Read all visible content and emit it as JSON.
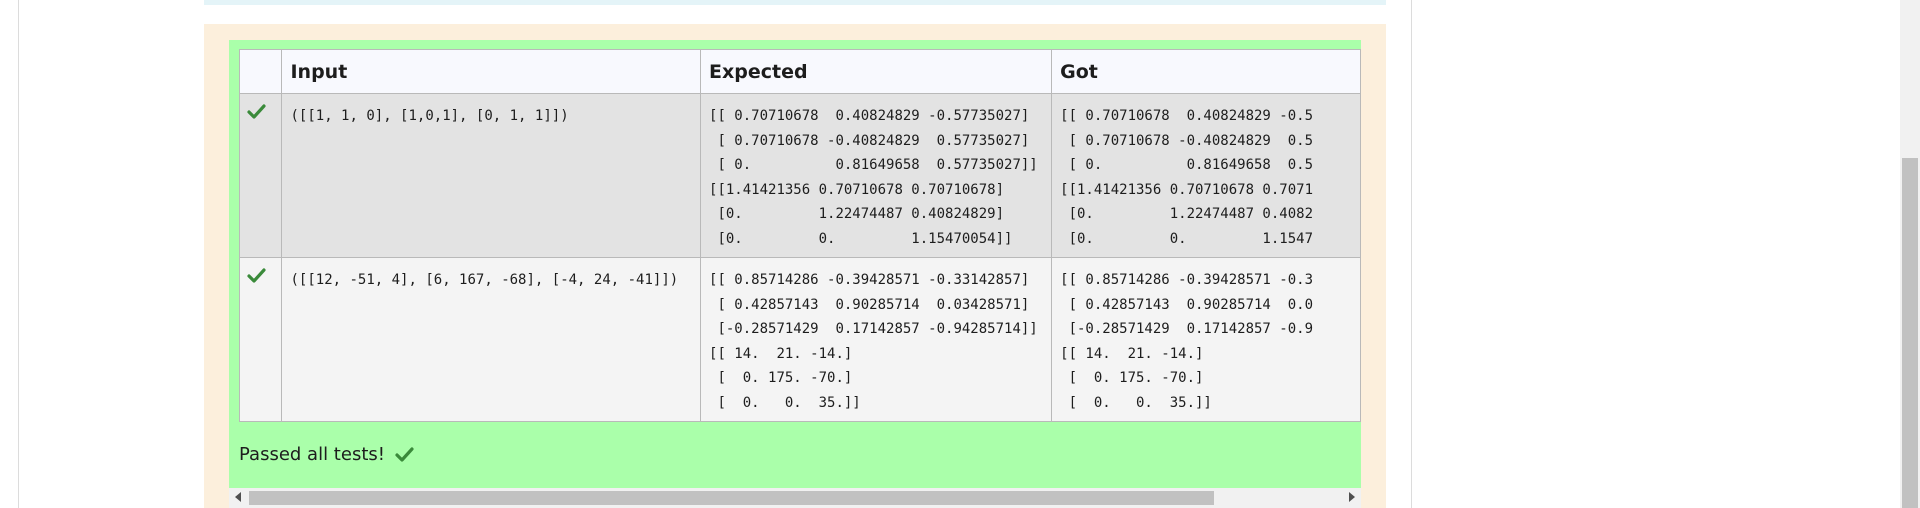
{
  "headers": {
    "input": "Input",
    "expected": "Expected",
    "got": "Got"
  },
  "rows": [
    {
      "input": "([[1, 1, 0], [1,0,1], [0, 1, 1]])",
      "expected": "[[ 0.70710678  0.40824829 -0.57735027]\n [ 0.70710678 -0.40824829  0.57735027]\n [ 0.          0.81649658  0.57735027]]\n[[1.41421356 0.70710678 0.70710678]\n [0.         1.22474487 0.40824829]\n [0.         0.         1.15470054]]",
      "got": "[[ 0.70710678  0.40824829 -0.5\n [ 0.70710678 -0.40824829  0.5\n [ 0.          0.81649658  0.5\n[[1.41421356 0.70710678 0.7071\n [0.         1.22474487 0.4082\n [0.         0.         1.1547"
    },
    {
      "input": "([[12, -51, 4], [6, 167, -68], [-4, 24, -41]])",
      "expected": "[[ 0.85714286 -0.39428571 -0.33142857]\n [ 0.42857143  0.90285714  0.03428571]\n [-0.28571429  0.17142857 -0.94285714]]\n[[ 14.  21. -14.]\n [  0. 175. -70.]\n [  0.   0.  35.]]",
      "got": "[[ 0.85714286 -0.39428571 -0.3\n [ 0.42857143  0.90285714  0.0\n [-0.28571429  0.17142857 -0.9\n[[ 14.  21. -14.]\n [  0. 175. -70.]\n [  0.   0.  35.]]"
    }
  ],
  "summary": "Passed all tests!",
  "colors": {
    "pass_green": "#aaffaa",
    "check_green": "#3a8a3a",
    "feedback_bg": "#fcefdc"
  },
  "icons": {
    "row_status": "check-icon",
    "summary": "check-icon"
  }
}
